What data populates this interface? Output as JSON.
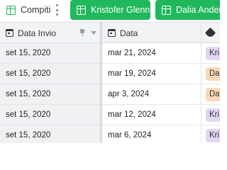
{
  "toolbar": {
    "current_view": "Compiti",
    "views": [
      {
        "label": "Kristofer Glenn"
      },
      {
        "label": "Dalia Anderse"
      }
    ],
    "accent_color": "#1fb85c"
  },
  "columns": [
    {
      "label": "Data Invio",
      "icon": "calendar-icon"
    },
    {
      "label": "Data",
      "icon": "calendar-icon"
    },
    {
      "label": "",
      "icon": "tag-icon"
    }
  ],
  "rows": [
    {
      "data_invio": "set 15, 2020",
      "data": "mar 21, 2024",
      "assignee": "Kri",
      "assignee_color": "#e3d6f5"
    },
    {
      "data_invio": "set 15, 2020",
      "data": "mar 19, 2024",
      "assignee": "Dal",
      "assignee_color": "#f9d9b8"
    },
    {
      "data_invio": "set 15, 2020",
      "data": "apr 3, 2024",
      "assignee": "Dal",
      "assignee_color": "#f9d9b8"
    },
    {
      "data_invio": "set 15, 2020",
      "data": "mar 12, 2024",
      "assignee": "Kri",
      "assignee_color": "#e3d6f5"
    },
    {
      "data_invio": "set 15, 2020",
      "data": "mar 6, 2024",
      "assignee": "Kri",
      "assignee_color": "#e3d6f5"
    }
  ]
}
